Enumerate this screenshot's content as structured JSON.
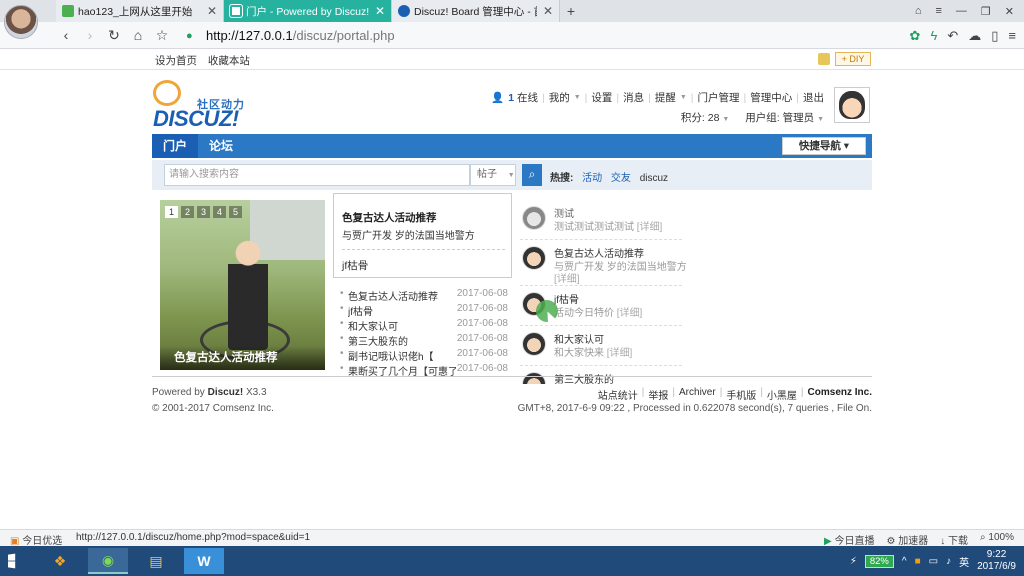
{
  "browser": {
    "tabs": [
      {
        "title": "hao123_上网从这里开始",
        "icon_color": "#4caf50"
      },
      {
        "title": "门户 - Powered by Discuz!",
        "icon_color": "#ffffff"
      },
      {
        "title": "Discuz! Board 管理中心 - 首页",
        "icon_color": "#1a5fb4"
      }
    ],
    "address": {
      "host": "http://127.0.0.1",
      "path": "/discuz/portal.php"
    },
    "favorites": [
      "设为首页",
      "收藏本站"
    ],
    "diy": "+ DIY"
  },
  "site": {
    "logo_slogan": "社区动力",
    "logo_word": "DISCUZ!",
    "user_nav": {
      "online": "1",
      "online_label": "在线",
      "items": [
        "我的",
        "设置",
        "消息",
        "提醒",
        "门户管理",
        "管理中心",
        "退出"
      ],
      "points": "积分: 28",
      "group": "用户组: 管理员"
    },
    "main_nav": [
      "门户",
      "论坛"
    ],
    "quick_nav": "快捷导航 ▾",
    "search": {
      "placeholder": "请输入搜索内容",
      "type": "帖子",
      "hot_label": "热搜:",
      "hot": [
        "活动",
        "交友",
        "discuz"
      ]
    },
    "slide": {
      "numbers": [
        "1",
        "2",
        "3",
        "4",
        "5"
      ],
      "caption": "色复古达人活动推荐"
    },
    "featured": {
      "title": "色复古达人活动推荐",
      "summary": "与贾广开发 岁的法国当地警方",
      "second": "jf枯骨"
    },
    "list": [
      {
        "title": "色复古达人活动推荐",
        "date": "2017-06-08"
      },
      {
        "title": "jf枯骨",
        "date": "2017-06-08"
      },
      {
        "title": "和大家认可",
        "date": "2017-06-08"
      },
      {
        "title": "第三大股东的",
        "date": "2017-06-08"
      },
      {
        "title": "副书记哦认识佬h【",
        "date": "2017-06-08"
      },
      {
        "title": "果断买了几个月【可惠了",
        "date": "2017-06-08"
      }
    ],
    "feed": [
      {
        "name": "测试",
        "msg": "测试测试测试测试",
        "more": "[详细]",
        "msg2": ""
      },
      {
        "name": "色复古达人活动推荐",
        "msg": "与贾广开发 岁的法国当地警方",
        "more": "",
        "msg2": "[详细]"
      },
      {
        "name": "jf枯骨",
        "msg": "活动今日特价",
        "more": "[详细]",
        "msg2": ""
      },
      {
        "name": "和大家认可",
        "msg": "和大家快来",
        "more": "[详细]",
        "msg2": ""
      },
      {
        "name": "第三大股东的",
        "msg": "",
        "more": "",
        "msg2": ""
      }
    ],
    "footer": {
      "powered": "Powered by",
      "brand": "Discuz!",
      "version": "X3.3",
      "copyright": "© 2001-2017 Comsenz Inc.",
      "links": [
        "站点统计",
        "举报",
        "Archiver",
        "手机版",
        "小黑屋"
      ],
      "company": "Comsenz Inc.",
      "stats": "GMT+8, 2017-6-9 09:22 , Processed in 0.622078 second(s), 7 queries , File On."
    }
  },
  "status": {
    "left": "今日优选",
    "url": "http://127.0.0.1/discuz/home.php?mod=space&uid=1",
    "right": [
      "今日直播",
      "加速器",
      "下载",
      "100%"
    ]
  },
  "taskbar": {
    "battery": "82%",
    "ime": "英",
    "time": "9:22",
    "date": "2017/6/9"
  }
}
